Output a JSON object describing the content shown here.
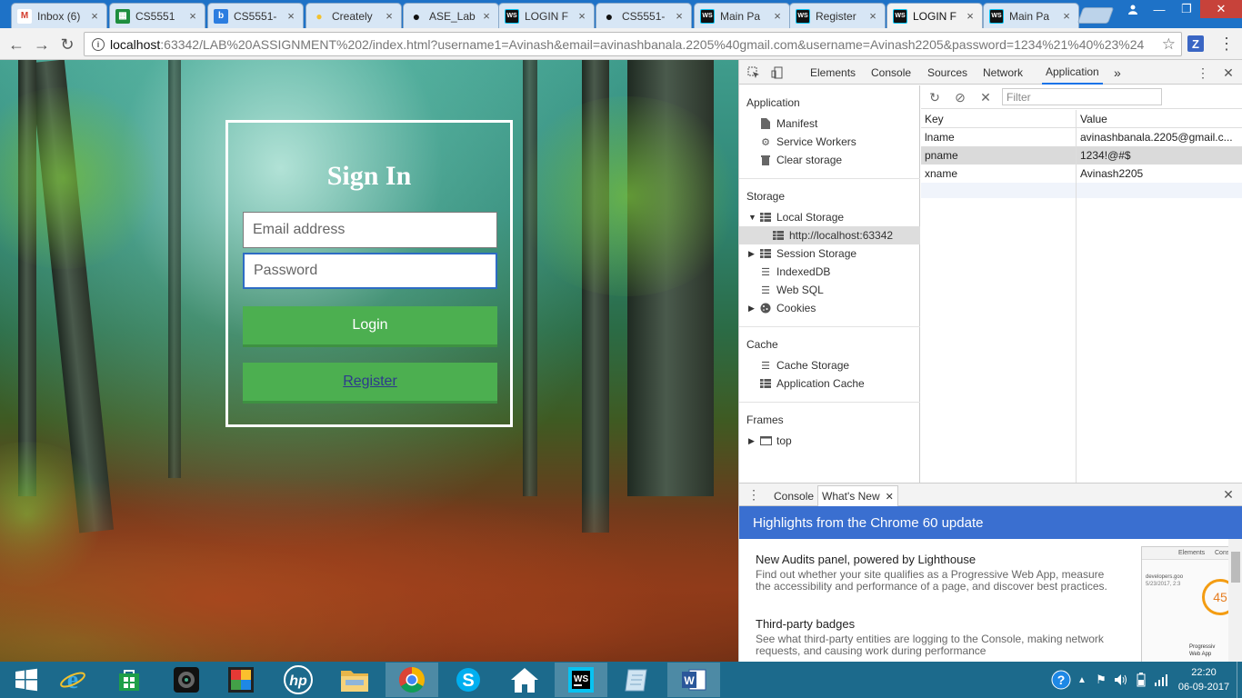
{
  "browser": {
    "tabs": [
      {
        "title": "Inbox (6)",
        "favicon": "gmail-icon",
        "color": "#d33b2c"
      },
      {
        "title": "CS5551",
        "favicon": "sheets-icon",
        "color": "#1e8e3e"
      },
      {
        "title": "CS5551-",
        "favicon": "box-icon",
        "color": "#2b7de0"
      },
      {
        "title": "Creately",
        "favicon": "creately-icon",
        "color": "#f2c12e"
      },
      {
        "title": "ASE_Lab",
        "favicon": "github-icon",
        "color": "#222222"
      },
      {
        "title": "LOGIN F",
        "favicon": "webstorm-icon",
        "color": "#111111"
      },
      {
        "title": "CS5551-",
        "favicon": "github-icon",
        "color": "#222222"
      },
      {
        "title": "Main Pa",
        "favicon": "webstorm-icon",
        "color": "#111111"
      },
      {
        "title": "Register",
        "favicon": "webstorm-icon",
        "color": "#111111"
      },
      {
        "title": "LOGIN F",
        "favicon": "webstorm-icon",
        "color": "#111111",
        "active": true
      },
      {
        "title": "Main Pa",
        "favicon": "webstorm-icon",
        "color": "#111111"
      }
    ],
    "url_host": "localhost",
    "url_rest": ":63342/LAB%20ASSIGNMENT%202/index.html?username1=Avinash&email=avinashbanala.2205%40gmail.com&username=Avinash2205&password=1234%21%40%23%24",
    "extension_label": "Z"
  },
  "login": {
    "title": "Sign In",
    "email_placeholder": "Email address",
    "password_placeholder": "Password",
    "login_label": "Login",
    "register_label": "Register",
    "accent": "#4caf50"
  },
  "devtools": {
    "tabs": [
      "Elements",
      "Console",
      "Sources",
      "Network",
      "Application"
    ],
    "active_tab": "Application",
    "more": "»",
    "sidebar": {
      "application_title": "Application",
      "application_items": [
        "Manifest",
        "Service Workers",
        "Clear storage"
      ],
      "storage_title": "Storage",
      "local_storage": "Local Storage",
      "local_origin": "http://localhost:63342",
      "storage_items": [
        "Session Storage",
        "IndexedDB",
        "Web SQL",
        "Cookies"
      ],
      "cache_title": "Cache",
      "cache_items": [
        "Cache Storage",
        "Application Cache"
      ],
      "frames_title": "Frames",
      "frames_item": "top"
    },
    "filter_placeholder": "Filter",
    "grid": {
      "headers": [
        "Key",
        "Value"
      ],
      "rows": [
        {
          "key": "lname",
          "value": "avinashbanala.2205@gmail.c..."
        },
        {
          "key": "pname",
          "value": "1234!@#$"
        },
        {
          "key": "xname",
          "value": "Avinash2205"
        }
      ]
    },
    "drawer": {
      "tabs": [
        "Console",
        "What's New"
      ],
      "banner": "Highlights from the Chrome 60 update",
      "items": [
        {
          "heading": "New Audits panel, powered by Lighthouse",
          "body": "Find out whether your site qualifies as a Progressive Web App, measure the accessibility and performance of a page, and discover best practices."
        },
        {
          "heading": "Third-party badges",
          "body": "See what third-party entities are logging to the Console, making network requests, and causing work during performance"
        }
      ],
      "thumb_text": {
        "elements": "Elements",
        "cons": "Cons",
        "url": "developers.goo",
        "date": "5/23/2017, 2:3",
        "score": "45",
        "caption1": "Progressiv",
        "caption2": "Web App"
      }
    }
  },
  "taskbar": {
    "clock_time": "22:20",
    "clock_date": "06-09-2017",
    "apps": [
      "windows-start-icon",
      "internet-explorer-icon",
      "store-icon",
      "camera-icon",
      "puzzle-icon",
      "hp-icon",
      "file-explorer-icon",
      "chrome-icon",
      "skype-icon",
      "home-icon",
      "webstorm-icon",
      "notes-icon",
      "word-icon"
    ]
  }
}
